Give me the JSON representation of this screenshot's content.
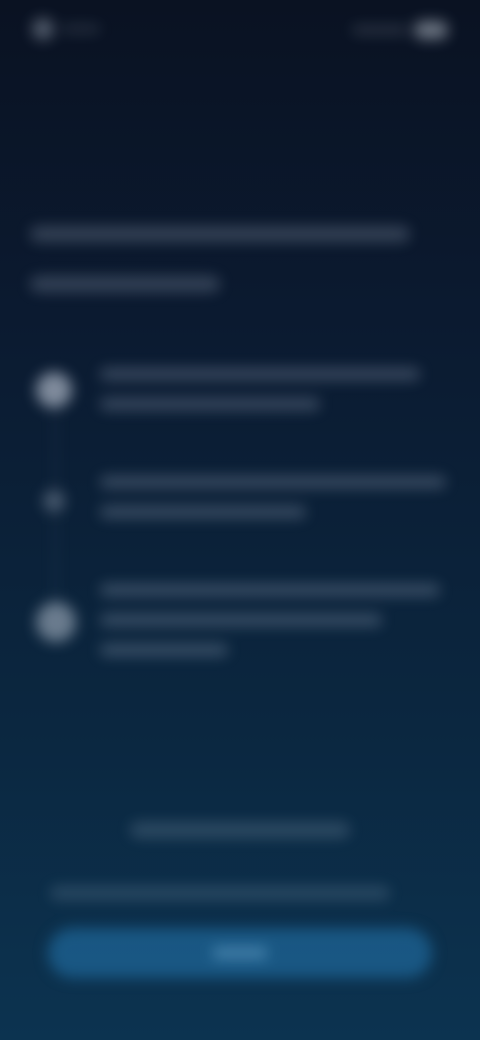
{
  "status_bar": {
    "left_icon": "circle-indicator-icon",
    "right_icon": "battery-pill-icon"
  },
  "header": {
    "title": ""
  },
  "steps": [
    {
      "icon": "step-large-circle-icon",
      "text": ""
    },
    {
      "icon": "step-small-circle-icon",
      "text": ""
    },
    {
      "icon": "step-large-circle-icon",
      "text": ""
    }
  ],
  "footer": {
    "secondary_link": "",
    "terms_text": "",
    "primary_button_label": ""
  },
  "colors": {
    "background_top": "#0a1222",
    "background_bottom": "#0c3350",
    "primary_button": "#1e6496"
  }
}
